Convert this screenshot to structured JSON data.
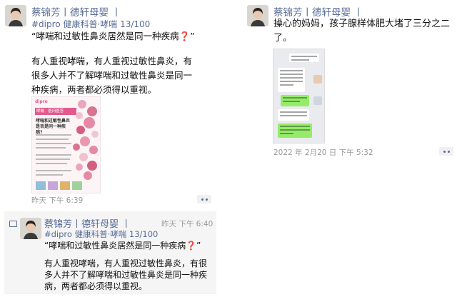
{
  "post1": {
    "author": "蔡锦芳丨德轩母婴 丨",
    "topic": "#dipro 健康科普·哮喘 13/100",
    "quote": "“哮喘和过敏性鼻炎居然是同一种疾病",
    "quote_mark": "❓",
    "quote_end": "”",
    "body": "有人重视哮喘，有人重视过敏性鼻炎，有很多人并不了解哮喘和过敏性鼻炎是同一种疾病，两者都必须得以重视。",
    "poster": {
      "brand": "dipro",
      "banner": "哮喘 · 医问医答",
      "headline": "哮喘和过敏性鼻炎是否是同一种疾病?"
    },
    "time": "昨天 下午 6:39"
  },
  "post2": {
    "author": "蔡锦芳丨德轩母婴 丨",
    "body": "操心的妈妈，孩子腺样体肥大堵了三分之二了。",
    "time": "2022 年 2月20 日 下午 5:32"
  },
  "post3": {
    "author": "蔡锦芳丨德轩母婴 丨",
    "time_right": "昨天 下午 6:40",
    "topic": "#dipro 健康科普·哮喘 13/100",
    "quote": "“哮喘和过敏性鼻炎居然是同一种疾病",
    "quote_mark": "❓",
    "quote_end": "”",
    "body": "有人重视哮喘，有人重视过敏性鼻炎，有很多人并不了解哮喘和过敏性鼻炎是同一种疾病，两者都必须得以重视。"
  },
  "icons": {
    "more": "more-dots-icon",
    "comment": "comment-icon"
  },
  "colors": {
    "link_blue": "#576b95",
    "poster_pink": "#e35a8c",
    "chat_green": "#95ec69"
  }
}
